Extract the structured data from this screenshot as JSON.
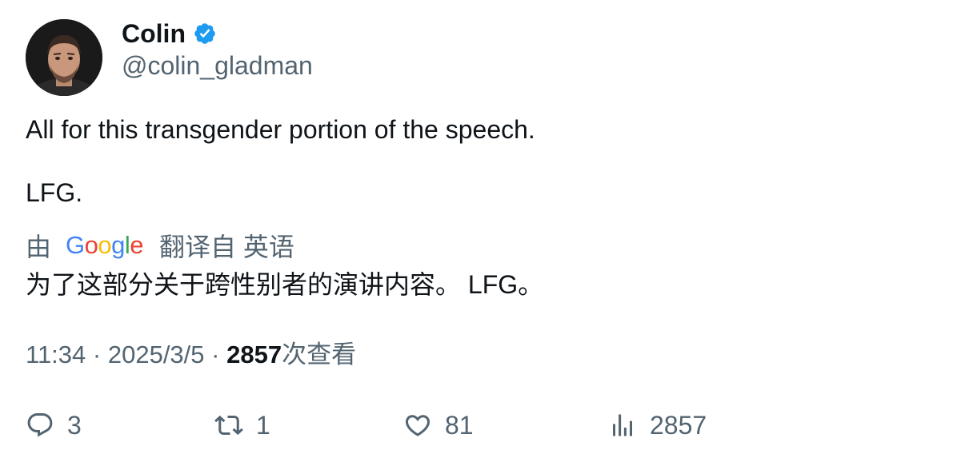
{
  "author": {
    "display_name": "Colin",
    "handle": "@colin_gladman",
    "verified": true,
    "avatar_icon": "profile-photo"
  },
  "tweet": {
    "line1": "All for this transgender portion of the speech.",
    "line2": "LFG."
  },
  "translation": {
    "by_label": "由",
    "provider_logo_text": "Google",
    "translated_from": "翻译自 英语",
    "translated_text": "为了这部分关于跨性别者的演讲内容。 LFG。"
  },
  "meta": {
    "time": "11:34",
    "date": "2025/3/5",
    "separator": "·",
    "views_count": "2857",
    "views_label": "次查看"
  },
  "actions": {
    "replies": "3",
    "retweets": "1",
    "likes": "81",
    "views": "2857"
  },
  "colors": {
    "primary_text": "#0f1419",
    "secondary_text": "#536471",
    "verified_blue": "#1d9bf0"
  }
}
